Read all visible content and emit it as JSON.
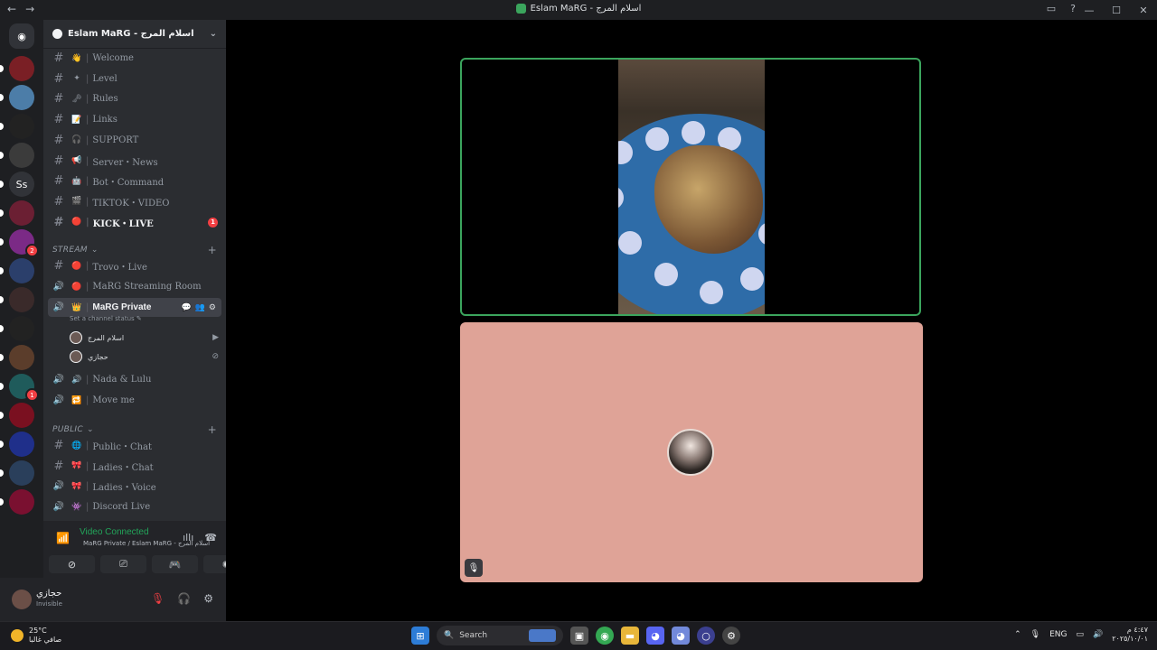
{
  "window": {
    "title": "Eslam MaRG - اسلام المرج",
    "nav_back": "←",
    "nav_forward": "→"
  },
  "server": {
    "name": "Eslam MaRG - اسلام المرج"
  },
  "channels": [
    {
      "type": "text",
      "emoji": "👋",
      "name": "Welcome"
    },
    {
      "type": "text",
      "emoji": "✦",
      "name": "Level"
    },
    {
      "type": "text",
      "emoji": "🗝",
      "name": "Rules"
    },
    {
      "type": "text",
      "emoji": "📝",
      "name": "Links"
    },
    {
      "type": "text",
      "emoji": "🎧",
      "name": "SUPPORT"
    },
    {
      "type": "text",
      "emoji": "📢",
      "name": "Server・News"
    },
    {
      "type": "text",
      "emoji": "🤖",
      "name": "Bot・Command"
    },
    {
      "type": "text",
      "emoji": "🎬",
      "name": "TIKTOK・VIDEO"
    },
    {
      "type": "text",
      "emoji": "🔴",
      "name": "KICK・LIVE",
      "unread": true,
      "badge": "1"
    }
  ],
  "category_stream": "STREAM",
  "stream_channels": [
    {
      "type": "text",
      "emoji": "🔴",
      "name": "Trovo・Live"
    },
    {
      "type": "voice",
      "emoji": "🔴",
      "name": "MaRG Streaming Room"
    },
    {
      "type": "voice",
      "emoji": "👑",
      "name": "MaRG Private",
      "status_placeholder": "Set a channel status ✎"
    },
    {
      "type": "voice",
      "emoji": "🔊",
      "name": "Nada & Lulu"
    },
    {
      "type": "voice",
      "emoji": "🔁",
      "name": "Move me"
    }
  ],
  "voice_users": [
    {
      "name": "اسلام المرج",
      "icon": "video-camera-icon"
    },
    {
      "name": "حجازي",
      "icon": "deafened-icon"
    }
  ],
  "category_public": "PUBLIC",
  "public_channels": [
    {
      "type": "text",
      "emoji": "🌐",
      "name": "Public・Chat"
    },
    {
      "type": "text",
      "emoji": "🎀",
      "name": "Ladies・Chat"
    },
    {
      "type": "voice",
      "emoji": "🎀",
      "name": "Ladies・Voice"
    },
    {
      "type": "voice",
      "emoji": "👾",
      "name": "Discord Live"
    }
  ],
  "voice_panel": {
    "status": "Video Connected",
    "location": "MaRG Private / Eslam MaRG - اسلام المرج"
  },
  "user_panel": {
    "name": "حجازي",
    "status": "Invisible"
  },
  "guilds": [
    {
      "label": ""
    },
    {
      "label": ""
    },
    {
      "label": ""
    },
    {
      "label": ""
    },
    {
      "label": "Ss"
    },
    {
      "label": ""
    },
    {
      "label": "",
      "badge": "2"
    },
    {
      "label": ""
    },
    {
      "label": ""
    },
    {
      "label": ""
    },
    {
      "label": ""
    },
    {
      "label": "",
      "badge": "1"
    },
    {
      "label": ""
    },
    {
      "label": ""
    },
    {
      "label": ""
    },
    {
      "label": ""
    }
  ],
  "taskbar": {
    "temperature": "25°C",
    "weather": "صافي غالبا",
    "search_placeholder": "Search",
    "language": "ENG",
    "time": "٤:٤٧ م",
    "date": "٢٠٢٥/١٠/٠١"
  },
  "colors": {
    "speaking_border": "#3ba55d",
    "tile_background": "#dfa397",
    "voice_connected": "#23a55a"
  }
}
